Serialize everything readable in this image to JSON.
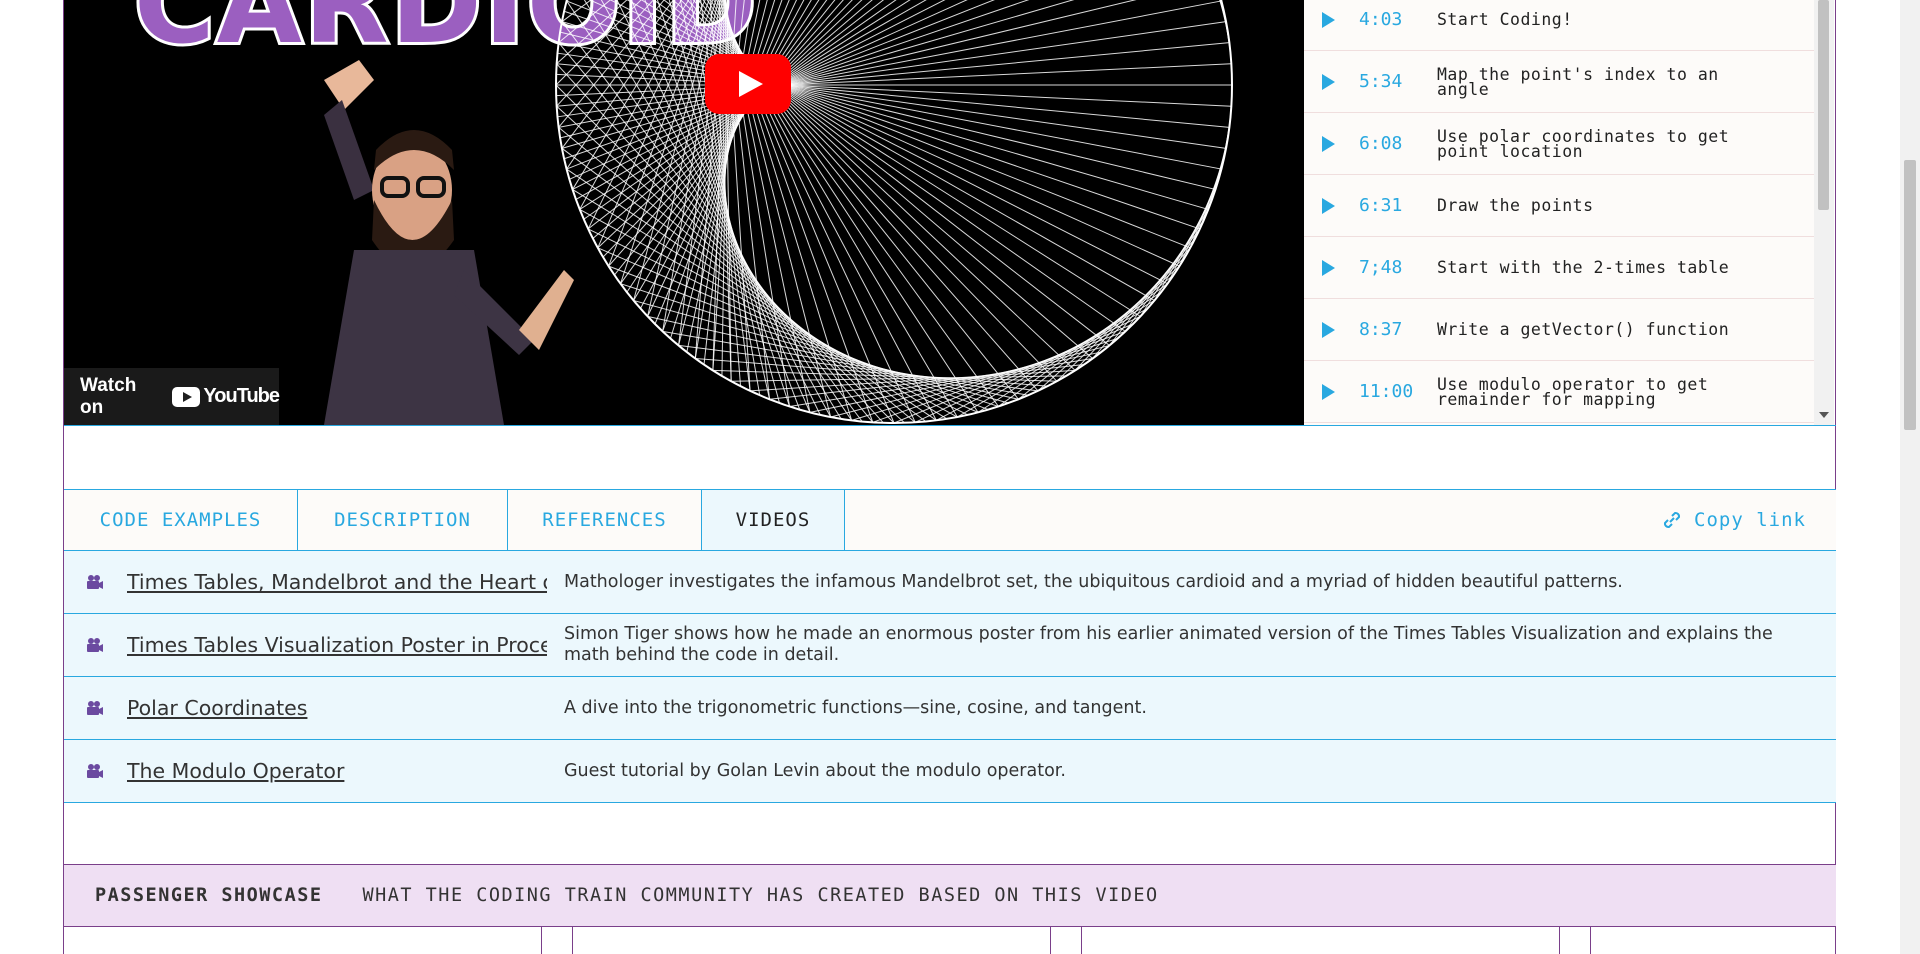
{
  "video": {
    "title_word": "CARDIOID",
    "watch_on_label": "Watch on",
    "youtube_label": "YouTube"
  },
  "chapters": [
    {
      "time": "4:03",
      "label": "Start Coding!"
    },
    {
      "time": "5:34",
      "label": "Map the point's index to an angle"
    },
    {
      "time": "6:08",
      "label": "Use polar coordinates to get point location"
    },
    {
      "time": "6:31",
      "label": "Draw the points"
    },
    {
      "time": "7;48",
      "label": "Start with the 2-times table"
    },
    {
      "time": "8:37",
      "label": "Write a getVector() function"
    },
    {
      "time": "11:00",
      "label": "Use modulo operator to get remainder for mapping"
    }
  ],
  "tabs": [
    {
      "label": "CODE EXAMPLES",
      "active": false
    },
    {
      "label": "DESCRIPTION",
      "active": false
    },
    {
      "label": "REFERENCES",
      "active": false
    },
    {
      "label": "VIDEOS",
      "active": true
    }
  ],
  "copy_link_label": "Copy link",
  "videos": [
    {
      "title": "Times Tables, Mandelbrot and the Heart of Mathematics",
      "description": "Mathologer investigates the infamous Mandelbrot set, the ubiquitous cardioid and a myriad of hidden beautiful patterns."
    },
    {
      "title": "Times Tables Visualization Poster in Processing",
      "description": "Simon Tiger shows how he made an enormous poster from his earlier animated version of the Times Tables Visualization and explains the math behind the code in detail."
    },
    {
      "title": "Polar Coordinates",
      "description": "A dive into the trigonometric functions—sine, cosine, and tangent."
    },
    {
      "title": "The Modulo Operator",
      "description": "Guest tutorial by Golan Levin about the modulo operator."
    }
  ],
  "showcase": {
    "heading": "PASSENGER SHOWCASE",
    "subheading": "WHAT THE CODING TRAIN COMMUNITY HAS CREATED BASED ON THIS VIDEO"
  },
  "colors": {
    "accent_blue": "#29a8e0",
    "frame_purple": "#7a3f8a",
    "row_background": "#ecf8fd",
    "showcase_background": "#efdff3",
    "youtube_red": "#ff0000"
  },
  "icons": {
    "chapter": "play-triangle-icon",
    "video_row": "video-camera-icon",
    "copy_link": "link-icon"
  }
}
